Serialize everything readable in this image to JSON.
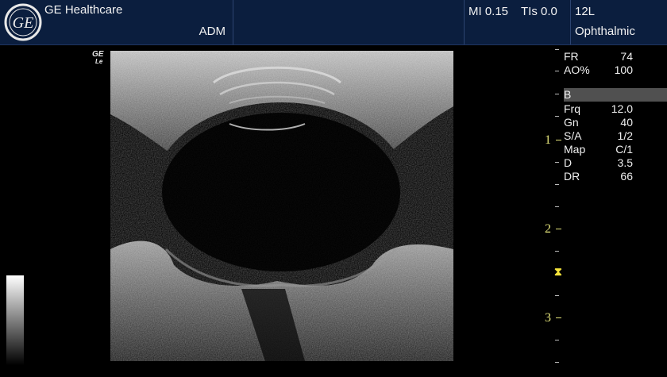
{
  "header": {
    "brand": "GE Healthcare",
    "mode": "ADM",
    "mi": "MI 0.15",
    "tis": "TIs 0.0",
    "probe": "12L",
    "preset": "Ophthalmic"
  },
  "image": {
    "orientation_logo_line1": "GE",
    "orientation_logo_line2": "Le"
  },
  "depth_scale": {
    "labels": [
      "1",
      "2",
      "3"
    ]
  },
  "params": {
    "fr_label": "FR",
    "fr_value": "74",
    "ao_label": "AO%",
    "ao_value": "100",
    "b_label": "B",
    "frq_label": "Frq",
    "frq_value": "12.0",
    "gn_label": "Gn",
    "gn_value": "40",
    "sa_label": "S/A",
    "sa_value": "1/2",
    "map_label": "Map",
    "map_value": "C/1",
    "d_label": "D",
    "d_value": "3.5",
    "dr_label": "DR",
    "dr_value": "66"
  },
  "colors": {
    "header_bg": "#0b1e3e",
    "depth_scale": "#e3e37a",
    "focus_marker": "#f4e33b",
    "orientation_marker": "#f2e23a"
  }
}
